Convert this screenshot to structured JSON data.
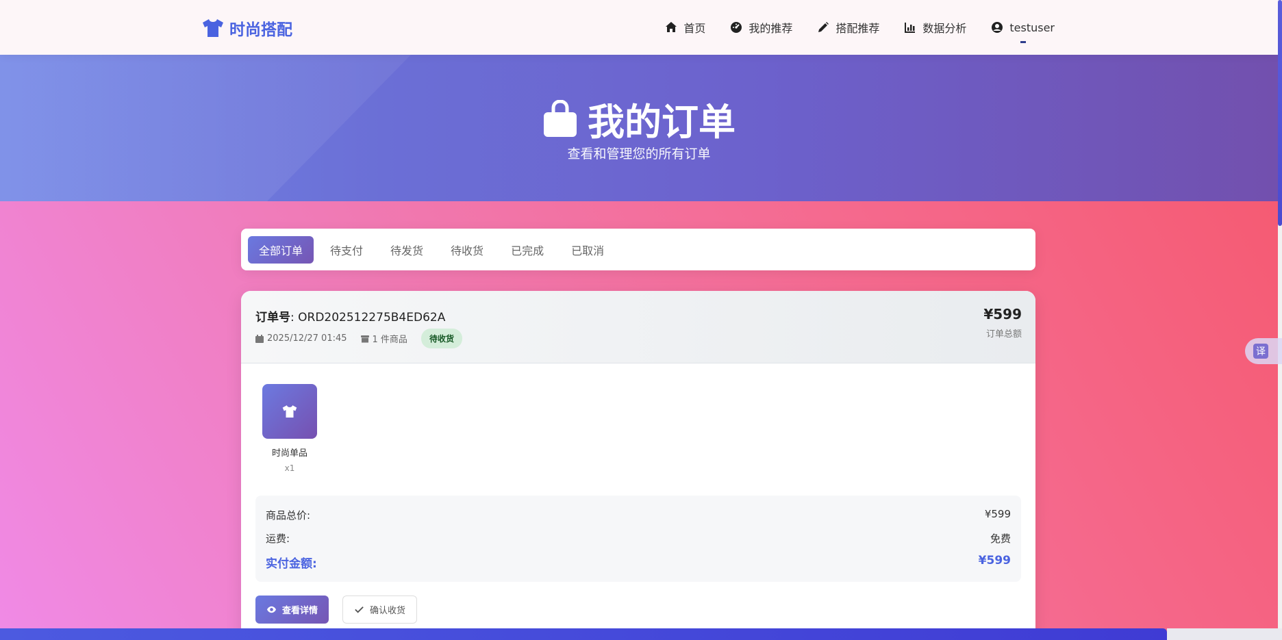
{
  "navbar": {
    "brand": "时尚搭配",
    "items": [
      {
        "label": "首页",
        "icon": "home-icon"
      },
      {
        "label": "我的推荐",
        "icon": "gauge-icon"
      },
      {
        "label": "搭配推荐",
        "icon": "pencil-icon"
      },
      {
        "label": "数据分析",
        "icon": "bar-chart-icon"
      },
      {
        "label": "testuser",
        "icon": "user-circle-icon"
      }
    ]
  },
  "hero": {
    "title": "我的订单",
    "subtitle": "查看和管理您的所有订单"
  },
  "tabs": [
    "全部订单",
    "待支付",
    "待发货",
    "待收货",
    "已完成",
    "已取消"
  ],
  "active_tab": "全部订单",
  "order": {
    "number_label": "订单号",
    "number": ": ORD202512275B4ED62A",
    "date": "2025/12/27 01:45",
    "item_count": "1 件商品",
    "status": "待收货",
    "total": "¥599",
    "total_label": "订单总额",
    "items": [
      {
        "name": "时尚单品",
        "qty": "x1"
      }
    ],
    "summary": {
      "subtotal_label": "商品总价:",
      "subtotal": "¥599",
      "shipping_label": "运费:",
      "shipping": "免费",
      "paid_label": "实付金额:",
      "paid": "¥599"
    },
    "actions": {
      "view_details": "查看详情",
      "confirm_receipt": "确认收货"
    }
  },
  "translate_label": "译",
  "colors": {
    "brand": "#4a63e0",
    "accent_gradient_start": "#6a79e0",
    "accent_gradient_end": "#7656b4",
    "status_bg": "#d4edda",
    "status_text": "#155724"
  }
}
